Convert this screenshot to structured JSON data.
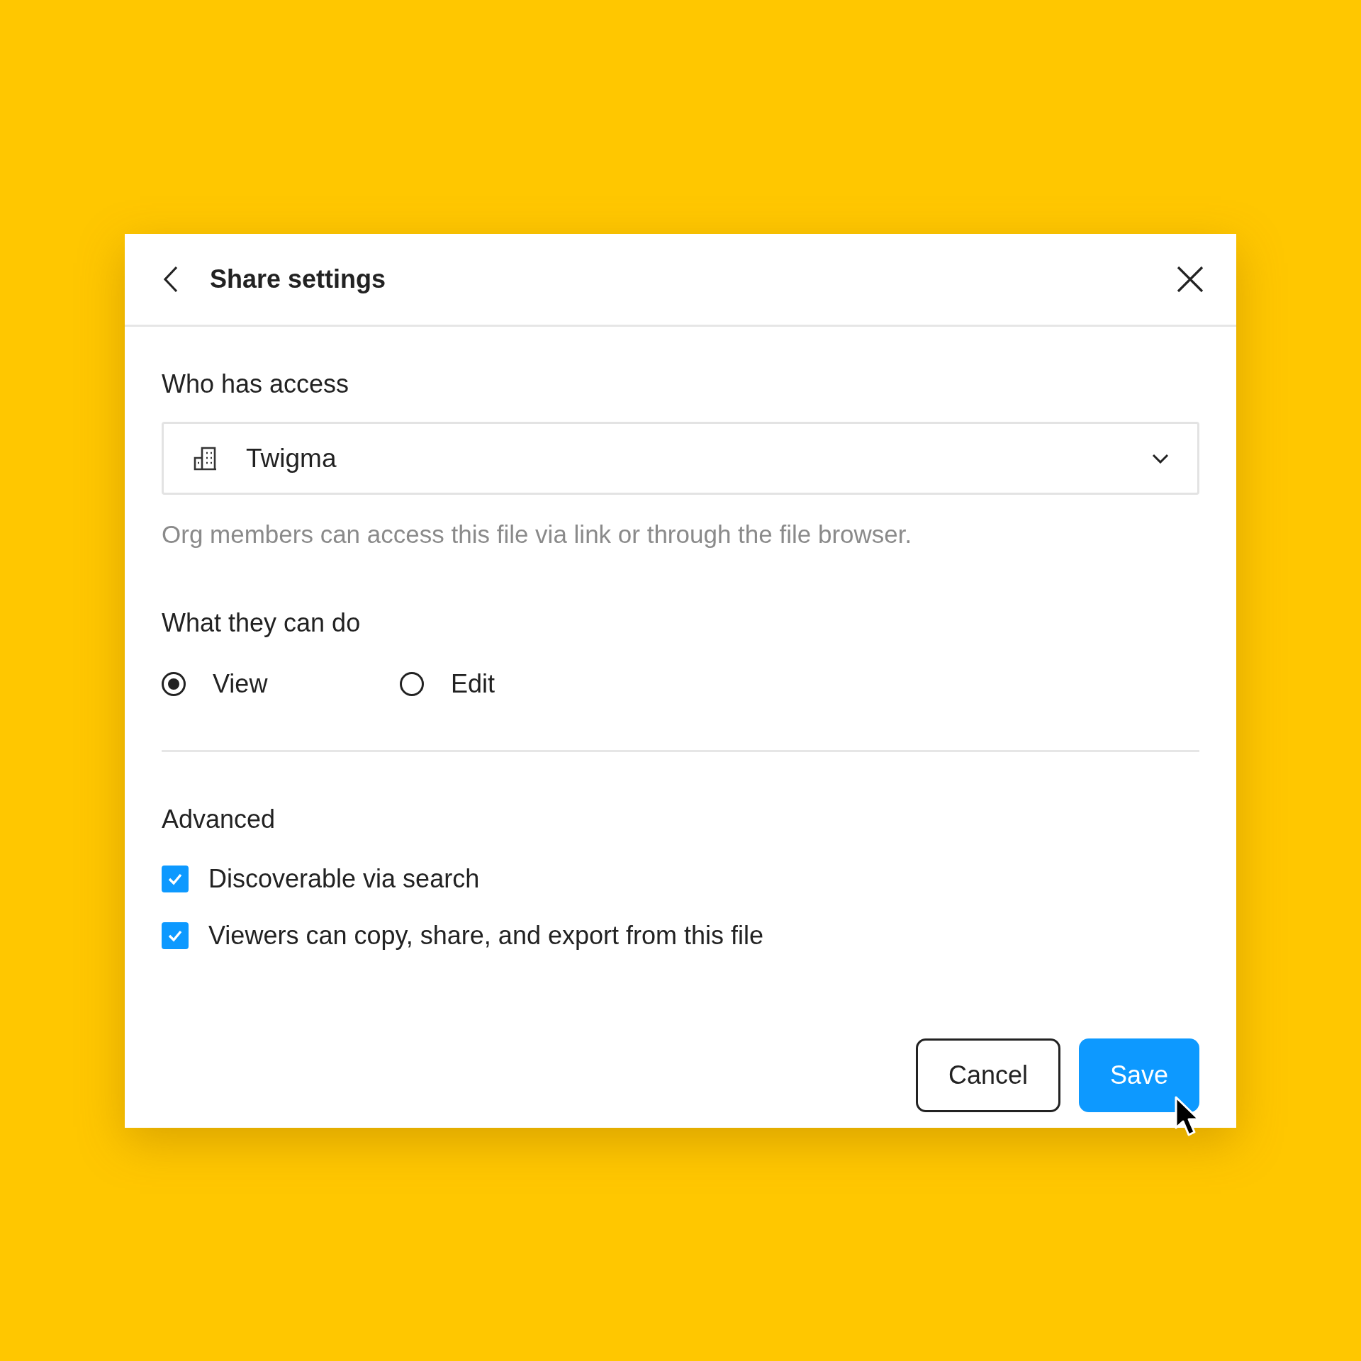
{
  "dialog": {
    "title": "Share settings"
  },
  "access": {
    "label": "Who has access",
    "value": "Twigma",
    "help": "Org members can access this file via link or through the file browser."
  },
  "permissions": {
    "label": "What they can do",
    "options": [
      {
        "label": "View",
        "selected": true
      },
      {
        "label": "Edit",
        "selected": false
      }
    ]
  },
  "advanced": {
    "label": "Advanced",
    "options": [
      {
        "label": "Discoverable via search",
        "checked": true
      },
      {
        "label": "Viewers can copy, share, and export from this file",
        "checked": true
      }
    ]
  },
  "buttons": [
    {
      "label": "Cancel",
      "kind": "secondary"
    },
    {
      "label": "Save",
      "kind": "primary"
    }
  ]
}
